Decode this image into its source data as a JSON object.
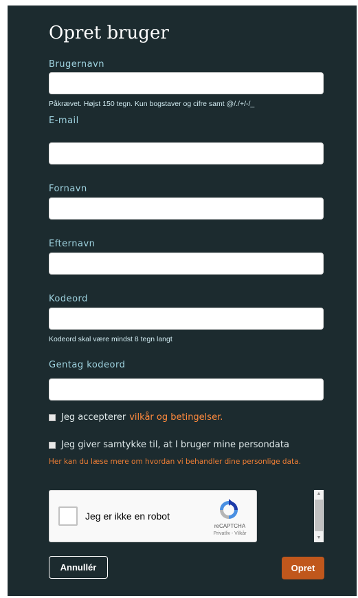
{
  "form": {
    "title": "Opret bruger",
    "fields": {
      "username": {
        "label": "Brugernavn",
        "value": "",
        "hint": "Påkrævet. Højst 150 tegn. Kun bogstaver og cifre samt @/./+/-/_"
      },
      "email": {
        "label": "E-mail",
        "value": ""
      },
      "first_name": {
        "label": "Fornavn",
        "value": ""
      },
      "last_name": {
        "label": "Efternavn",
        "value": ""
      },
      "password": {
        "label": "Kodeord",
        "value": "",
        "hint": "Kodeord skal være mindst 8 tegn langt"
      },
      "password_repeat": {
        "label": "Gentag kodeord",
        "value": ""
      }
    },
    "terms": {
      "prefix": "Jeg accepterer",
      "link": "vilkår og betingelser.",
      "checked": false
    },
    "consent": {
      "label": "Jeg giver samtykke til, at I bruger mine persondata",
      "note": "Her kan du læse mere om hvordan vi behandler dine personlige data.",
      "checked": false
    },
    "recaptcha": {
      "label": "Jeg er ikke en robot",
      "brand": "reCAPTCHA",
      "terms": "Privatliv - Vilkår"
    },
    "buttons": {
      "cancel": "Annullér",
      "submit": "Opret"
    }
  },
  "colors": {
    "background": "#1c2b2f",
    "label": "#9fd3e0",
    "accent": "#ff8a3d",
    "submit": "#c0571c"
  }
}
